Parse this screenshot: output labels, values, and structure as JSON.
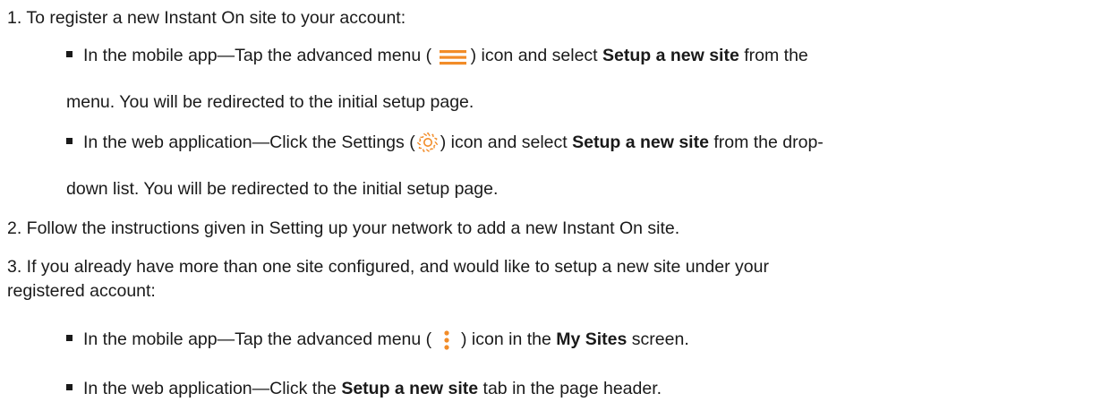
{
  "step1": {
    "intro": "1. To register a new Instant On site to your account:",
    "mobile_a": "In the mobile app—Tap the advanced menu (",
    "mobile_b": ") icon and select ",
    "mobile_bold": "Setup a new site",
    "mobile_c": " from the",
    "mobile_cont": "menu. You will be redirected to the initial setup page.",
    "web_a": "In the web application—Click the Settings (",
    "web_b": ") icon and select ",
    "web_bold": "Setup a new site",
    "web_c": " from the drop-",
    "web_cont": "down list. You will be redirected to the initial setup page."
  },
  "step2": {
    "text": "2. Follow the instructions given in Setting up your network to add a new Instant On site."
  },
  "step3": {
    "intro_1": "3. If you already have more than one site configured, and would like to setup a new site under your",
    "intro_2": "registered account:",
    "mobile_a": "In the mobile app—Tap the advanced menu (",
    "mobile_b": ") icon in the ",
    "mobile_bold": "My Sites",
    "mobile_c": " screen.",
    "web_a": "In the web application—Click the ",
    "web_bold": "Setup a new site",
    "web_b": " tab in the page header."
  },
  "icons": {
    "hamburger": "hamburger-menu-icon",
    "settings": "gear-icon",
    "kebab": "kebab-menu-icon"
  },
  "colors": {
    "accent": "#F28C28",
    "text": "#1a1a1a"
  }
}
